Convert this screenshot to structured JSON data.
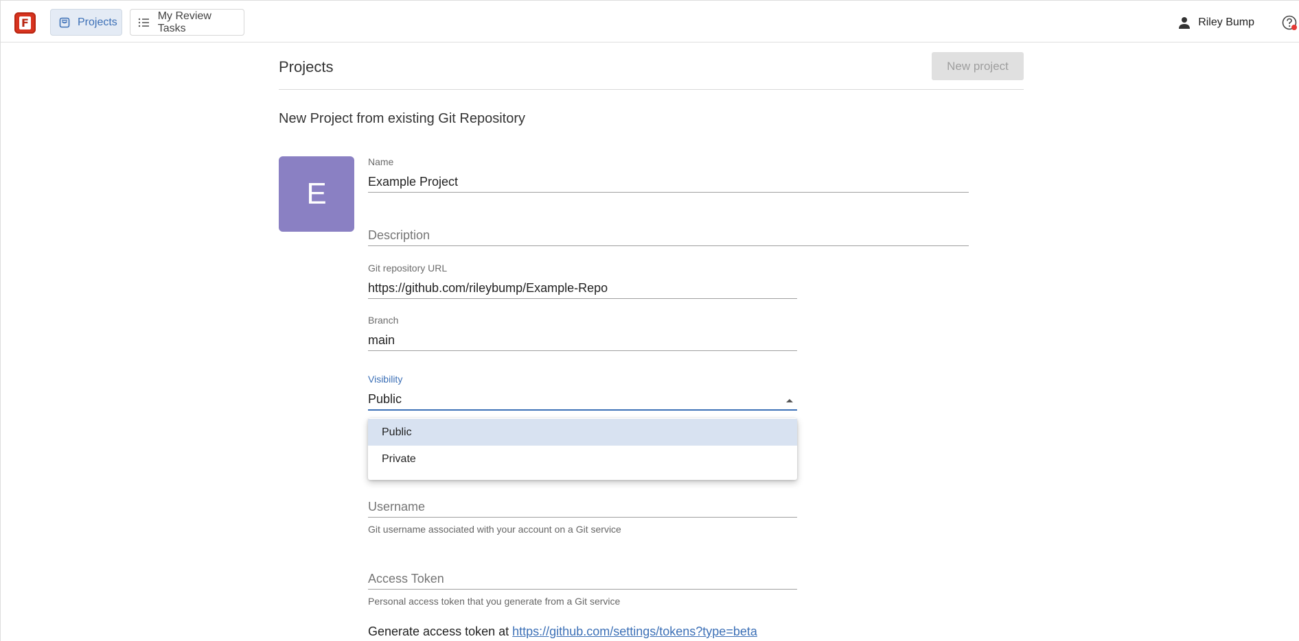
{
  "topbar": {
    "logo_letter": "F",
    "nav": [
      {
        "label": "Projects",
        "icon": "projects-icon",
        "active": true
      },
      {
        "label": "My Review Tasks",
        "icon": "list-icon",
        "active": false
      }
    ],
    "user_name": "Riley Bump",
    "help_icon": "help-icon"
  },
  "main": {
    "title": "Projects",
    "new_project_label": "New project",
    "section_title": "New Project from existing Git Repository",
    "avatar_letter": "E",
    "avatar_color": "#8a80c3"
  },
  "form": {
    "name_label": "Name",
    "name_value": "Example Project",
    "description_placeholder": "Description",
    "git_url_label": "Git repository URL",
    "git_url_value": "https://github.com/rileybump/Example-Repo",
    "branch_label": "Branch",
    "branch_value": "main",
    "visibility_label": "Visibility",
    "visibility_value": "Public",
    "visibility_options": [
      "Public",
      "Private"
    ],
    "username_placeholder": "Username",
    "username_hint": "Git username associated with your account on a Git service",
    "token_placeholder": "Access Token",
    "token_hint": "Personal access token that you generate from a Git service",
    "generate_text": "Generate access token at",
    "generate_link": "https://github.com/settings/tokens?type=beta"
  },
  "colors": {
    "accent": "#3b6fb6",
    "active_nav_bg": "#e4ebf5",
    "selected_option_bg": "#d8e2f1",
    "logo_red": "#d7331f"
  }
}
